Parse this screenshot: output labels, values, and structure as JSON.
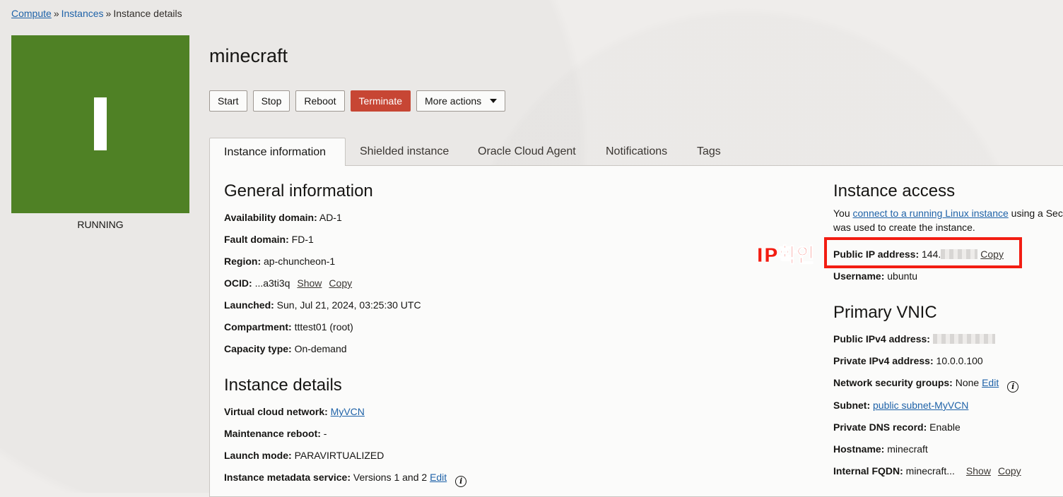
{
  "breadcrumb": {
    "items": [
      "Compute",
      "Instances",
      "Instance details"
    ],
    "separator": "»"
  },
  "instance": {
    "status": "RUNNING",
    "letter": "I",
    "name": "minecraft",
    "tile_color": "#4f8125"
  },
  "actions": {
    "start": "Start",
    "stop": "Stop",
    "reboot": "Reboot",
    "terminate": "Terminate",
    "more": "More actions"
  },
  "tabs": [
    "Instance information",
    "Shielded instance",
    "Oracle Cloud Agent",
    "Notifications",
    "Tags"
  ],
  "general": {
    "title": "General information",
    "availability_domain": {
      "label": "Availability domain:",
      "value": "AD-1"
    },
    "fault_domain": {
      "label": "Fault domain:",
      "value": "FD-1"
    },
    "region": {
      "label": "Region:",
      "value": "ap-chuncheon-1"
    },
    "ocid": {
      "label": "OCID:",
      "value": "...a3ti3q",
      "show": "Show",
      "copy": "Copy"
    },
    "launched": {
      "label": "Launched:",
      "value": "Sun, Jul 21, 2024, 03:25:30 UTC"
    },
    "compartment": {
      "label": "Compartment:",
      "value": "tttest01 (root)"
    },
    "capacity": {
      "label": "Capacity type:",
      "value": "On-demand"
    }
  },
  "details": {
    "title": "Instance details",
    "vcn": {
      "label": "Virtual cloud network:",
      "value": "MyVCN"
    },
    "maintenance": {
      "label": "Maintenance reboot:",
      "value": "-"
    },
    "launch_mode": {
      "label": "Launch mode:",
      "value": "PARAVIRTUALIZED"
    },
    "metadata": {
      "label": "Instance metadata service:",
      "value": "Versions 1 and 2",
      "edit": "Edit"
    }
  },
  "access": {
    "title": "Instance access",
    "line1_pre": "You ",
    "line1_link": "connect to a running Linux instance",
    "line1_post": " using a Sec",
    "line2": "was used to create the instance.",
    "public_ip": {
      "label": "Public IP address:",
      "value": "144.",
      "copy": "Copy"
    },
    "username": {
      "label": "Username:",
      "value": "ubuntu"
    }
  },
  "vnic": {
    "title": "Primary VNIC",
    "public_ipv4": {
      "label": "Public IPv4 address:"
    },
    "private_ipv4": {
      "label": "Private IPv4 address:",
      "value": "10.0.0.100"
    },
    "nsg": {
      "label": "Network security groups:",
      "value": "None",
      "edit": "Edit"
    },
    "subnet": {
      "label": "Subnet:",
      "value": "public subnet-MyVCN"
    },
    "dns": {
      "label": "Private DNS record:",
      "value": "Enable"
    },
    "hostname": {
      "label": "Hostname:",
      "value": "minecraft"
    },
    "fqdn": {
      "label": "Internal FQDN:",
      "value": "minecraft...",
      "show": "Show",
      "copy": "Copy"
    }
  },
  "annotation": {
    "text": "IP확인",
    "color": "#f21d12"
  },
  "info_icon": "i"
}
